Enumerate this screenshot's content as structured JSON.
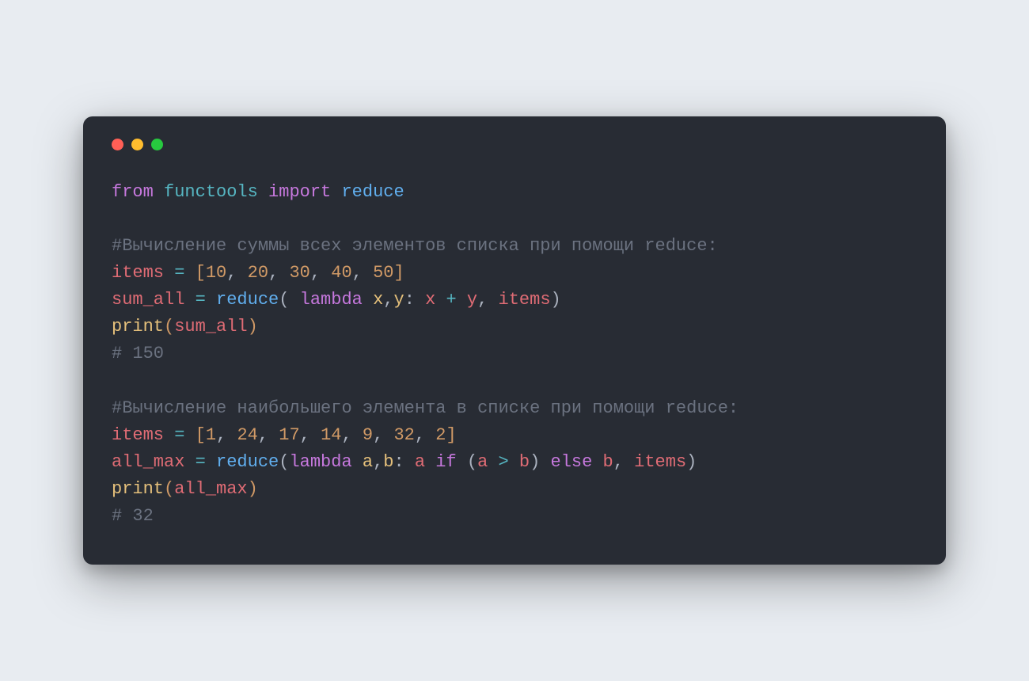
{
  "colors": {
    "background_page": "#e8ecf1",
    "background_window": "#282c34",
    "traffic_red": "#ff5f56",
    "traffic_yellow": "#ffbd2e",
    "traffic_green": "#27c93f",
    "text_default": "#abb2bf",
    "keyword": "#c678dd",
    "module": "#56b6c2",
    "identifier_blue": "#61afef",
    "comment": "#6b7280",
    "variable_red": "#e06c75",
    "number": "#d19a66",
    "builtin_yellow": "#e5c07b"
  },
  "code": {
    "line1": {
      "from": "from",
      "module": "functools",
      "import": "import",
      "name": "reduce"
    },
    "blank1": "",
    "comment1": "#Вычисление суммы всех элементов списка при помощи reduce:",
    "line_items1": {
      "var": "items",
      "eq": "=",
      "lb": "[",
      "n1": "10",
      "c1": ",",
      "n2": "20",
      "c2": ",",
      "n3": "30",
      "c3": ",",
      "n4": "40",
      "c4": ",",
      "n5": "50",
      "rb": "]"
    },
    "line_sum": {
      "var": "sum_all",
      "eq": "=",
      "reduce": "reduce",
      "lp": "(",
      "lambda": "lambda",
      "x": "x",
      "comma_xy": ",",
      "y": "y",
      "colon": ":",
      "x2": "x",
      "plus": "+",
      "y2": "y",
      "comma_args": ",",
      "items": "items",
      "rp": ")"
    },
    "line_print1": {
      "print": "print",
      "lp": "(",
      "arg": "sum_all",
      "rp": ")"
    },
    "comment_out1": "# 150",
    "blank2": "",
    "comment2": "#Вычисление наибольшего элемента в списке при помощи reduce:",
    "line_items2": {
      "var": "items",
      "eq": "=",
      "lb": "[",
      "n1": "1",
      "c1": ",",
      "n2": "24",
      "c2": ",",
      "n3": "17",
      "c3": ",",
      "n4": "14",
      "c4": ",",
      "n5": "9",
      "c5": ",",
      "n6": "32",
      "c6": ",",
      "n7": "2",
      "rb": "]"
    },
    "line_max": {
      "var": "all_max",
      "eq": "=",
      "reduce": "reduce",
      "lp": "(",
      "lambda": "lambda",
      "a": "a",
      "comma_ab": ",",
      "b": "b",
      "colon": ":",
      "a2": "a",
      "if": "if",
      "lp2": "(",
      "a3": "a",
      "gt": ">",
      "b2": "b",
      "rp2": ")",
      "else": "else",
      "b3": "b",
      "comma_args": ",",
      "items": "items",
      "rp": ")"
    },
    "line_print2": {
      "print": "print",
      "lp": "(",
      "arg": "all_max",
      "rp": ")"
    },
    "comment_out2": "# 32"
  }
}
